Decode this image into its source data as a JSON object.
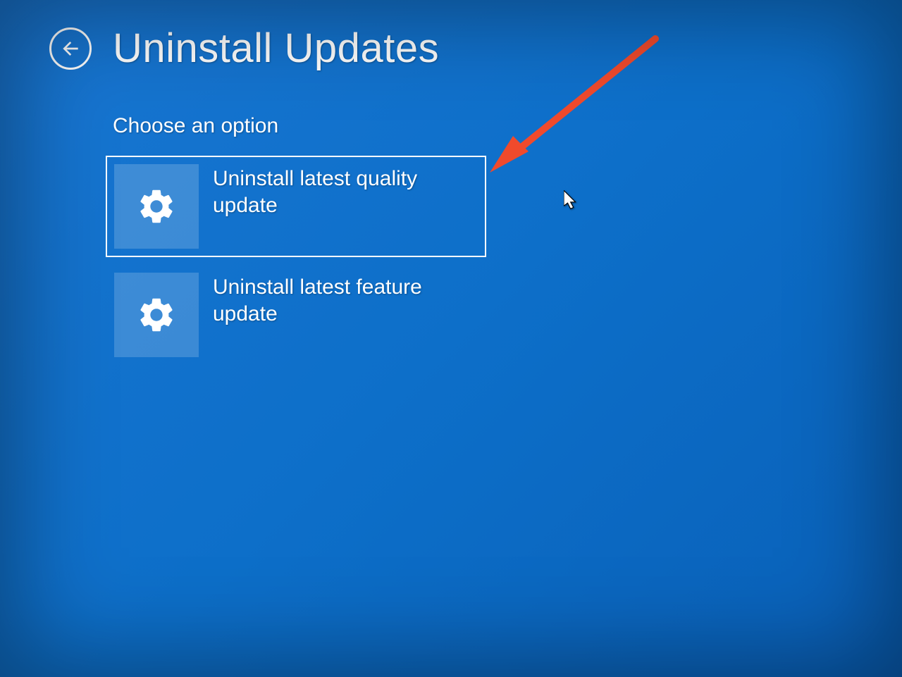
{
  "header": {
    "title": "Uninstall Updates"
  },
  "subtitle": "Choose an option",
  "options": [
    {
      "label": "Uninstall latest quality update",
      "icon": "gear-icon",
      "selected": true
    },
    {
      "label": "Uninstall latest feature update",
      "icon": "gear-icon",
      "selected": false
    }
  ],
  "annotation": {
    "arrow_color": "#f04a2c"
  }
}
